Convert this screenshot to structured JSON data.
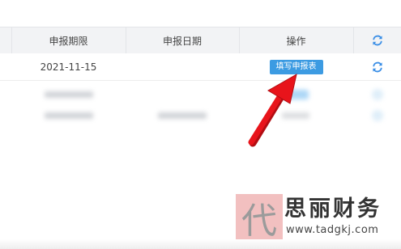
{
  "table": {
    "columns": [
      "申报期限",
      "申报日期",
      "操作"
    ],
    "rows": [
      {
        "deadline": "2021-11-15",
        "filed_date": "",
        "action_label": "填写申报表"
      }
    ]
  },
  "colors": {
    "header_bg": "#f2f3f5",
    "button_bg": "#3c9be2",
    "arrow": "#e8141b"
  },
  "watermark": {
    "logo_char": "代",
    "name": "思丽财务",
    "url": "www.tadgkj.com"
  }
}
